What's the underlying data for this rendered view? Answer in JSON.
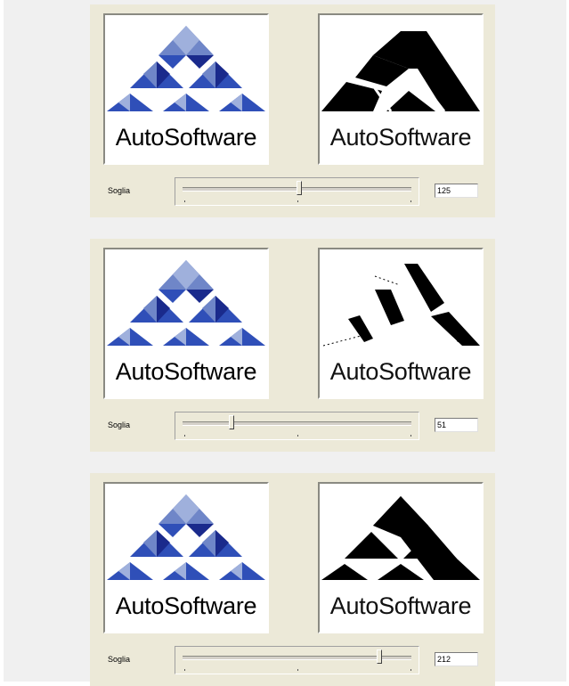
{
  "panels": [
    {
      "threshold_label": "Soglia",
      "threshold_value": "125",
      "slider_fraction": 0.49,
      "original_logo_text": "AutoSoftware",
      "binary_logo_text": "AutoSoftware"
    },
    {
      "threshold_label": "Soglia",
      "threshold_value": "51",
      "slider_fraction": 0.2,
      "original_logo_text": "AutoSoftware",
      "binary_logo_text": "AutoSoftware"
    },
    {
      "threshold_label": "Soglia",
      "threshold_value": "212",
      "slider_fraction": 0.84,
      "original_logo_text": "AutoSoftware",
      "binary_logo_text": "AutoSoftware"
    }
  ],
  "colors": {
    "panel_bg": "#ece9d8",
    "logo_dark_blue": "#1a2a8c",
    "logo_mid_blue": "#2f4fb8",
    "logo_light_blue": "#6f86c8",
    "logo_pale_blue": "#9fb0dc"
  }
}
